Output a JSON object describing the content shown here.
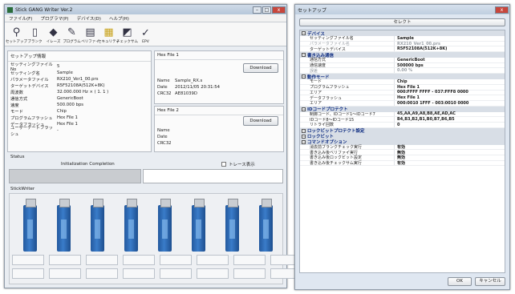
{
  "left": {
    "title": "Stick GANG Writer Ver.2",
    "controls": [
      "–",
      "□",
      "x"
    ],
    "menu": [
      "ファイル(F)",
      "プログラマ(P)",
      "デバイス(D)",
      "ヘルプ(H)"
    ],
    "tools": [
      {
        "label": "セットアップ",
        "icon": "search-icon",
        "glyph": "⚲"
      },
      {
        "label": "ブランク",
        "icon": "blank-page-icon",
        "glyph": "▯"
      },
      {
        "label": "イレーズ",
        "icon": "erase-icon",
        "glyph": "◆"
      },
      {
        "label": "プログラム",
        "icon": "program-icon",
        "glyph": "✎"
      },
      {
        "label": "ベリファイ",
        "icon": "verify-icon",
        "glyph": "▤"
      },
      {
        "label": "セキュリティ",
        "icon": "lock-icon",
        "glyph": "▦"
      },
      {
        "label": "チェックサム",
        "icon": "checksum-icon",
        "glyph": "◩"
      },
      {
        "label": "EPV",
        "icon": "epv-icon",
        "glyph": "✓"
      }
    ],
    "setup": {
      "title": "セットアップ情報",
      "rows": [
        {
          "k": "セッティングファイルNo",
          "v": "5"
        },
        {
          "k": "セッティング名",
          "v": "Sample"
        },
        {
          "k": "パラメータファイル",
          "v": "RX210_Ver1_00.prs"
        },
        {
          "k": "ターゲットデバイス",
          "v": "R5F52108A(512K+8K)"
        },
        {
          "k": "周波数",
          "v": "32.000.000 Hz × ( 1. 1 )"
        },
        {
          "k": "通信方式",
          "v": "GenericBoot"
        },
        {
          "k": "速度",
          "v": "500.000 bps"
        },
        {
          "k": "モード",
          "v": "Chip"
        },
        {
          "k": "プログラムフラッシュ",
          "v": "Hex File 1"
        },
        {
          "k": "データフラッシュ",
          "v": "Hex File 1"
        },
        {
          "k": "ユーザーデートフラッシュ",
          "v": "-"
        }
      ]
    },
    "hex1": {
      "title": "Hex File 1",
      "button": "Download",
      "rows": [
        {
          "k": "Name",
          "v": "Sample_RX.s"
        },
        {
          "k": "Date",
          "v": "2012/11/05 20:31:54"
        },
        {
          "k": "CRC32",
          "v": "AE81039D"
        }
      ]
    },
    "hex2": {
      "title": "Hex File 2",
      "button": "Download",
      "rows": [
        {
          "k": "Name",
          "v": ""
        },
        {
          "k": "Date",
          "v": ""
        },
        {
          "k": "CRC32",
          "v": ""
        }
      ]
    },
    "status": {
      "label": "Status",
      "message": "Initialization Completion",
      "trace": "トレース表示"
    },
    "writers": {
      "label": "StickWriter",
      "count": 8
    }
  },
  "right": {
    "title": "セットアップ",
    "select_button": "セレクト",
    "groups": [
      {
        "name": "デバイス",
        "rows": [
          {
            "k": "セッティングファイル名",
            "v": "Sample",
            "dim": false
          },
          {
            "k": "パラメータファイル名",
            "v": "RX210_Ver1_00.prs",
            "dim": true
          },
          {
            "k": "ターゲットデバイス",
            "v": "R5F52108A(512K+8K)",
            "dim": false
          }
        ]
      },
      {
        "name": "書き込み通信",
        "rows": [
          {
            "k": "通信方式",
            "v": "GenericBoot",
            "dim": false
          },
          {
            "k": "通信速度",
            "v": "500000 bps",
            "dim": false
          },
          {
            "k": "誤差",
            "v": "0.00 %",
            "dim": true
          }
        ]
      },
      {
        "name": "動作モード",
        "rows": [
          {
            "k": "モード",
            "v": "Chip",
            "dim": false
          },
          {
            "k": "プログラムフラッシュ",
            "v": "Hex File 1",
            "dim": false
          },
          {
            "k": "エリア",
            "v": "000:FFFF FFFF - 037:FFF8 0000",
            "dim": false
          },
          {
            "k": "データフラッシュ",
            "v": "Hex File 1",
            "dim": false
          },
          {
            "k": "エリア",
            "v": "000:0010 1FFF - 003:0010 0000",
            "dim": false
          }
        ]
      },
      {
        "name": "IDコードプロテクト",
        "rows": [
          {
            "k": "制御コード、IDコード1〜IDコード7",
            "v": "45,AA,A9,A8,B8,AE,AD,AC",
            "dim": false
          },
          {
            "k": "IDコード8〜IDコード15",
            "v": "B4,B3,B2,B1,B0,B7,B6,B5",
            "dim": false
          },
          {
            "k": "リトライ回数",
            "v": "0",
            "dim": false
          }
        ]
      },
      {
        "name": "ロックビットプロテクト設定",
        "rows": []
      },
      {
        "name": "ロックビット",
        "rows": []
      },
      {
        "name": "コマンドオプション",
        "rows": [
          {
            "k": "消去前ブランクチェック実行",
            "v": "有効",
            "dim": false
          },
          {
            "k": "書き込み後ベリファイ実行",
            "v": "無効",
            "dim": false
          },
          {
            "k": "書き込み後ロックビット設定",
            "v": "無効",
            "dim": false
          },
          {
            "k": "書き込み後チェックサム実行",
            "v": "有効",
            "dim": false
          }
        ]
      }
    ],
    "ok": "OK",
    "cancel": "キャンセル"
  }
}
